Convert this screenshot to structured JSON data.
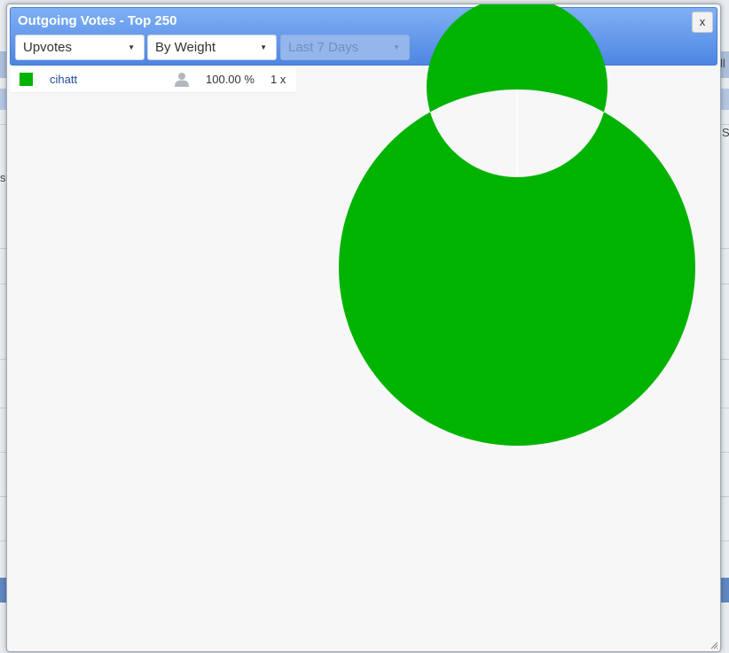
{
  "dialog": {
    "title": "Outgoing Votes - Top 250",
    "close_label": "x"
  },
  "filters": {
    "vote_type": "Upvotes",
    "sort": "By Weight",
    "period": "Last 7 Days"
  },
  "legend": [
    {
      "name": "cihatt",
      "percent": "100.00 %",
      "count": "1 x",
      "color": "#00b300",
      "icon": "user-icon"
    }
  ],
  "chart_data": {
    "type": "pie",
    "donut": true,
    "labels": [
      "cihatt"
    ],
    "values": [
      100
    ],
    "colors": [
      "#00b300"
    ]
  },
  "background": {
    "fragments": [
      "s",
      "ll",
      "S"
    ]
  }
}
